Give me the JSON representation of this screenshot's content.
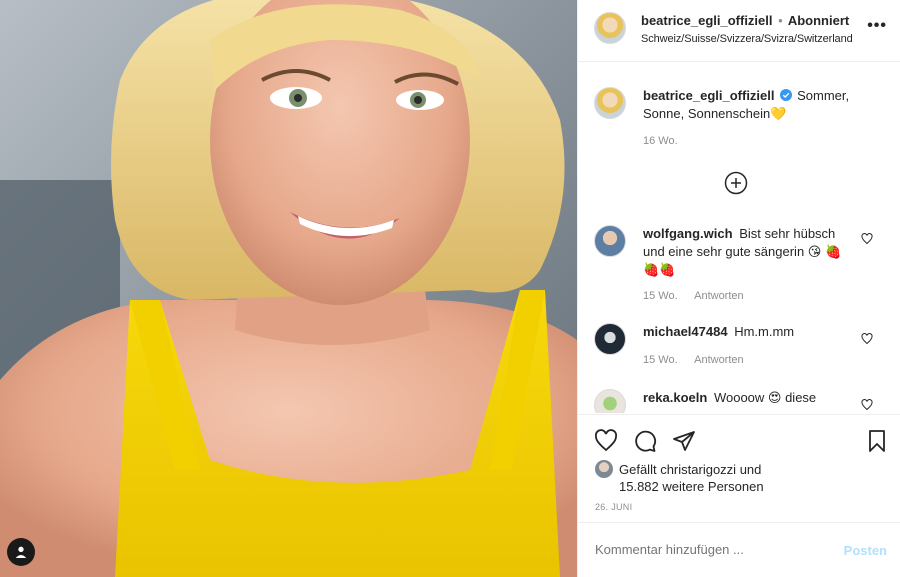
{
  "header": {
    "username": "beatrice_egli_offiziell",
    "separator": "•",
    "follow_label": "Abonniert",
    "location": "Schweiz/Suisse/Svizzera/Svizra/Switzerland",
    "more_icon": "more-horizontal-icon"
  },
  "caption": {
    "username": "beatrice_egli_offiziell",
    "text": "Sommer, Sonne, Sonnenschein💛",
    "time": "16 Wo."
  },
  "load_more_icon": "plus-circle-icon",
  "comments": [
    {
      "username": "wolfgang.wich",
      "text": "Bist sehr hübsch und eine sehr gute sängerin 😘 🍓🍓🍓",
      "time": "15 Wo.",
      "reply_label": "Antworten"
    },
    {
      "username": "michael47484",
      "text": "Hm.m.mm",
      "time": "15 Wo.",
      "reply_label": "Antworten"
    },
    {
      "username": "reka.koeln",
      "text": "Woooow 😍 diese"
    }
  ],
  "likes": {
    "prefix": "Gefällt",
    "user": "christarigozzi",
    "connector": "und",
    "others": "15.882 weitere Personen"
  },
  "date": "26. JUNI",
  "add_comment": {
    "placeholder": "Kommentar hinzufügen ...",
    "post_label": "Posten"
  },
  "colors": {
    "link_blue": "#0095f6",
    "post_disabled": "#b2dffc",
    "muted_text": "#8e8e8e",
    "top_yellow": "#f7d90c"
  }
}
